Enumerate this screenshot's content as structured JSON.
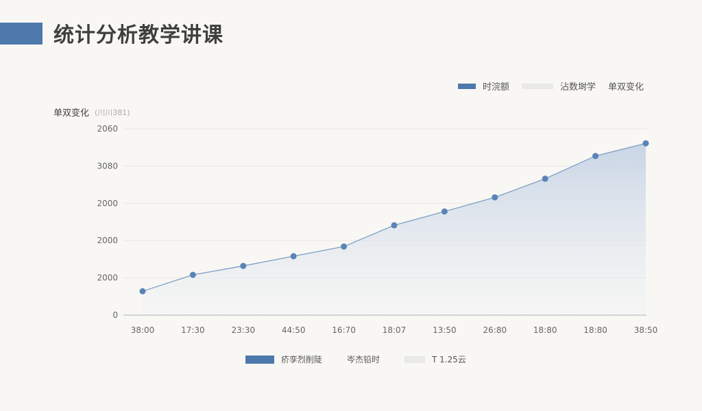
{
  "page": {
    "title": "统计分析教学讲课"
  },
  "legend_top": [
    {
      "label": "时浣额",
      "color": "#4d79ac"
    },
    {
      "label": "沾数埘学",
      "color": "#e9e9e7"
    },
    {
      "label": "单双变化",
      "color": ""
    }
  ],
  "legend_bottom": [
    {
      "label": "疥孪烈削陡",
      "color": "#4d79ac"
    },
    {
      "label": "岑杰铅时",
      "color": ""
    },
    {
      "label": "T 1.25云",
      "color": "#e9e9e7"
    }
  ],
  "chart_data": {
    "type": "area",
    "ylabel": "单双变化",
    "yunit": "(川川381)",
    "y_tick_labels": [
      "0",
      "2000",
      "2000",
      "2000",
      "3080",
      "2060"
    ],
    "ylim": [
      0,
      5000
    ],
    "categories": [
      "38:00",
      "17:30",
      "23:30",
      "44:50",
      "16:70",
      "18:07",
      "13:50",
      "26:80",
      "18:80",
      "18:80",
      "38:50"
    ],
    "values": [
      640,
      1080,
      1320,
      1580,
      1840,
      2410,
      2780,
      3160,
      3660,
      4270,
      4610
    ],
    "grid": true,
    "line_color": "#7c9fc6",
    "point_color": "#5a84b5",
    "fill_top_color": "#c6d3e5"
  }
}
